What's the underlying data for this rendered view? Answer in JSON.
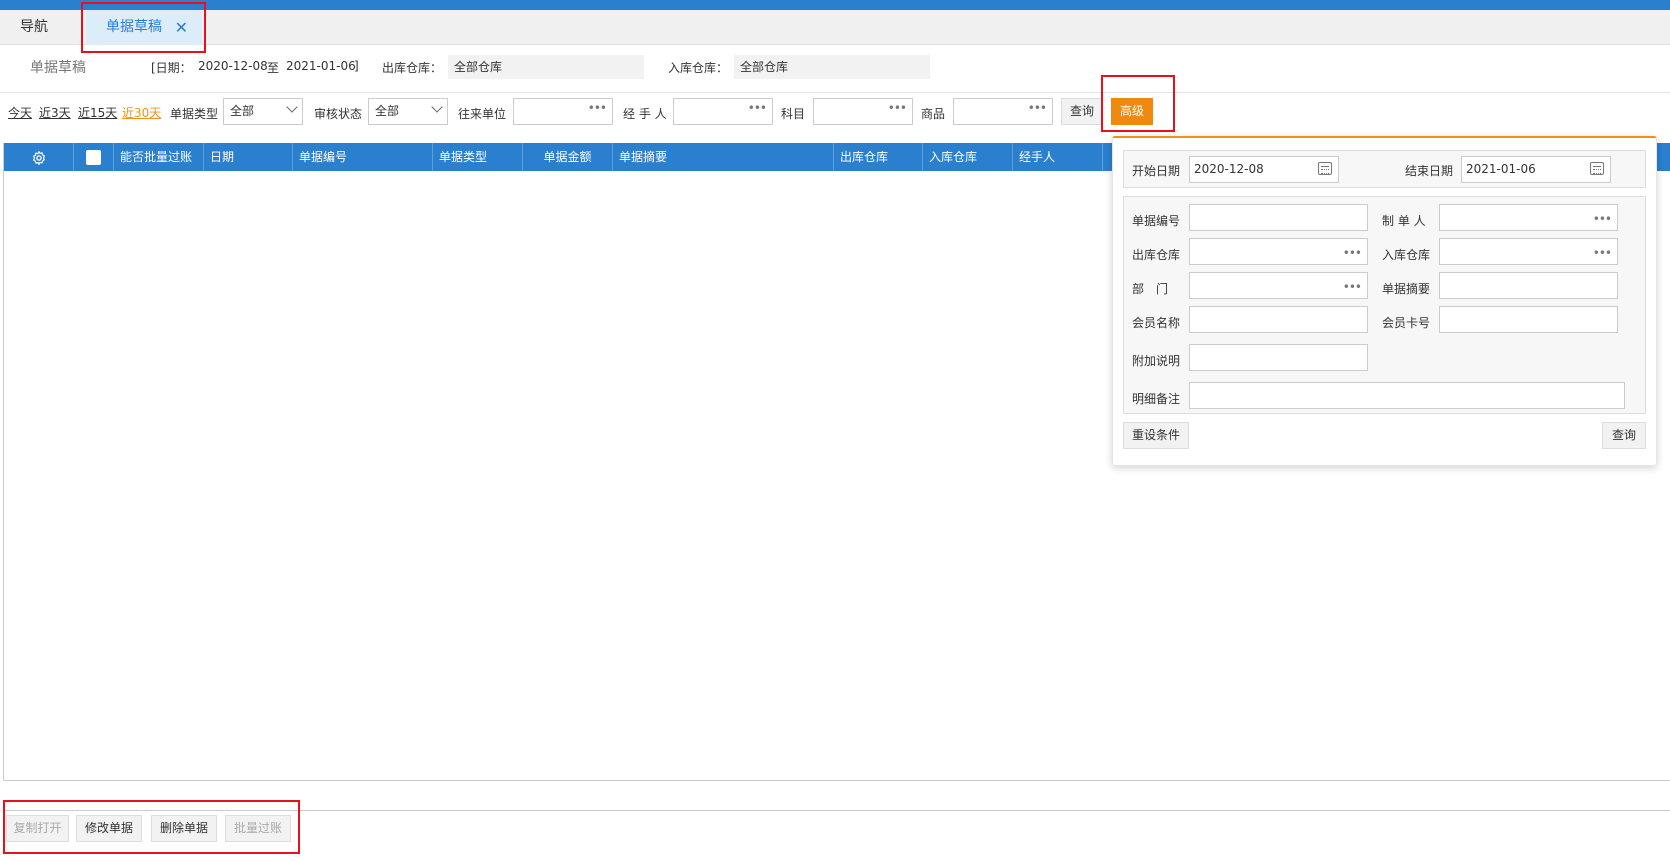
{
  "tabs": {
    "nav": "导航",
    "active": "单据草稿"
  },
  "info": {
    "page_title": "单据草稿",
    "date_prefix": "[日期：",
    "date_start": "2020-12-08",
    "date_sep": "至",
    "date_end": "2021-01-06",
    "date_suffix": "]",
    "out_wh_label": "出库仓库：",
    "out_wh_value": "全部仓库",
    "in_wh_label": "入库仓库：",
    "in_wh_value": "全部仓库"
  },
  "filters": {
    "quick": [
      "今天",
      "近3天",
      "近15天",
      "近30天"
    ],
    "doc_type_label": "单据类型",
    "doc_type_value": "全部",
    "audit_label": "审核状态",
    "audit_value": "全部",
    "partner_label": "往来单位",
    "handler_label": "经 手 人",
    "subject_label": "科目",
    "product_label": "商品",
    "query_btn": "查询",
    "advanced_btn": "高级",
    "dots": "•••"
  },
  "grid": {
    "columns": [
      "能否批量过账",
      "日期",
      "单据编号",
      "单据类型",
      "单据金额",
      "单据摘要",
      "出库仓库",
      "入库仓库",
      "经手人"
    ]
  },
  "bottom_buttons": {
    "copy_open": "复制打开",
    "edit": "修改单据",
    "delete": "删除单据",
    "batch_post": "批量过账"
  },
  "advanced": {
    "start_date_label": "开始日期",
    "start_date_value": "2020-12-08",
    "end_date_label": "结束日期",
    "end_date_value": "2021-01-06",
    "doc_no_label": "单据编号",
    "maker_label": "制 单 人",
    "out_wh_label": "出库仓库",
    "in_wh_label": "入库仓库",
    "dept_label": "部　门",
    "summary_label": "单据摘要",
    "member_name_label": "会员名称",
    "member_card_label": "会员卡号",
    "extra_note_label": "附加说明",
    "detail_note_label": "明细备注",
    "reset_btn": "重设条件",
    "query_btn": "查询"
  },
  "colors": {
    "primary": "#2a7fcf",
    "accent": "#f08a0e",
    "highlight": "#e8101a"
  }
}
